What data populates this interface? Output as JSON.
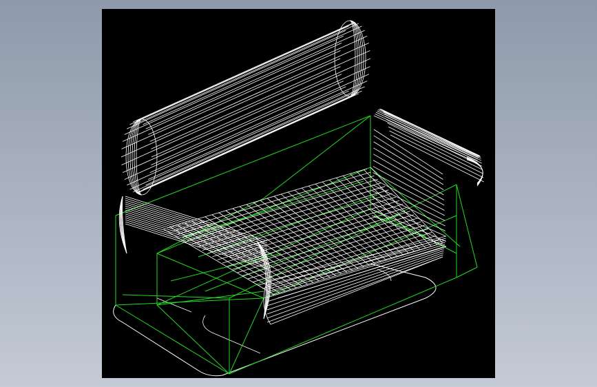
{
  "scene": {
    "subject": "sofa-wireframe-model",
    "render_mode": "wireframe",
    "colors": {
      "background": "#8e9aaa",
      "viewport_background": "#000000",
      "mesh_lines": "#ffffff",
      "construction_lines": "#22dd22"
    }
  }
}
